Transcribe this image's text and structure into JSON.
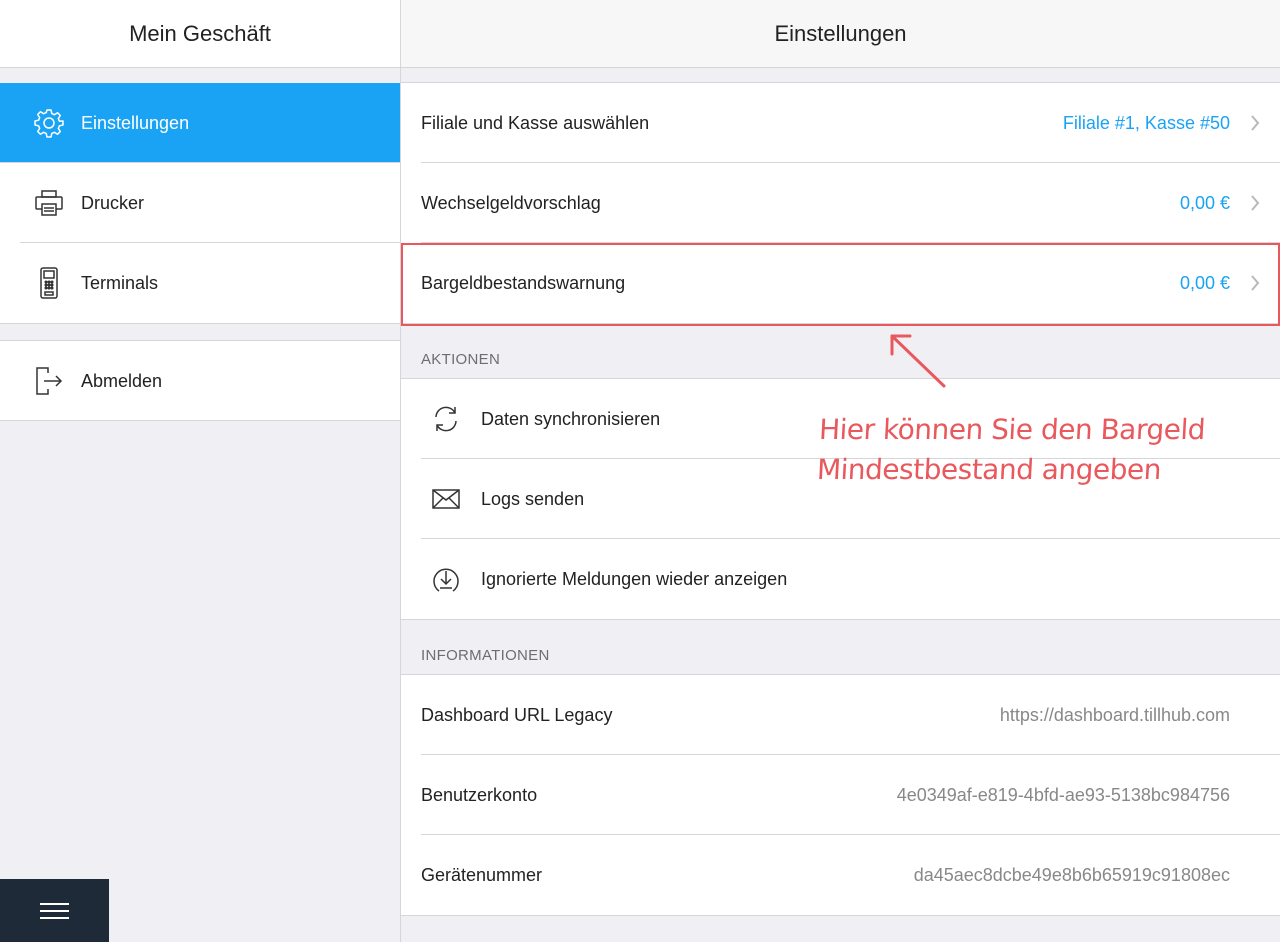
{
  "sidebar": {
    "title": "Mein Geschäft",
    "items": [
      {
        "label": "Einstellungen",
        "icon": "gear-icon",
        "active": true
      },
      {
        "label": "Drucker",
        "icon": "printer-icon",
        "active": false
      },
      {
        "label": "Terminals",
        "icon": "card-terminal-icon",
        "active": false
      }
    ],
    "logout": {
      "label": "Abmelden",
      "icon": "logout-icon"
    },
    "menu_icon": "hamburger-menu-icon"
  },
  "main": {
    "title": "Einstellungen",
    "settings": [
      {
        "label": "Filiale und Kasse auswählen",
        "value": "Filiale #1, Kasse #50"
      },
      {
        "label": "Wechselgeldvorschlag",
        "value": "0,00 €"
      },
      {
        "label": "Bargeldbestandswarnung",
        "value": "0,00 €"
      }
    ],
    "actions": {
      "title": "AKTIONEN",
      "items": [
        {
          "label": "Daten synchronisieren",
          "icon": "sync-icon"
        },
        {
          "label": "Logs senden",
          "icon": "envelope-icon"
        },
        {
          "label": "Ignorierte Meldungen wieder anzeigen",
          "icon": "download-circle-icon"
        }
      ]
    },
    "info": {
      "title": "INFORMATIONEN",
      "items": [
        {
          "label": "Dashboard URL Legacy",
          "value": "https://dashboard.tillhub.com"
        },
        {
          "label": "Benutzerkonto",
          "value": "4e0349af-e819-4bfd-ae93-5138bc984756"
        },
        {
          "label": "Gerätenummer",
          "value": "da45aec8dcbe49e8b6b65919c91808ec"
        }
      ]
    }
  },
  "annotation": {
    "line1": "Hier können Sie den Bargeld",
    "line2": "Mindestbestand angeben"
  },
  "colors": {
    "accent": "#1aa3f5",
    "annotation": "#e8585c",
    "background": "#efeff4",
    "menu_button": "#1e2a38"
  }
}
